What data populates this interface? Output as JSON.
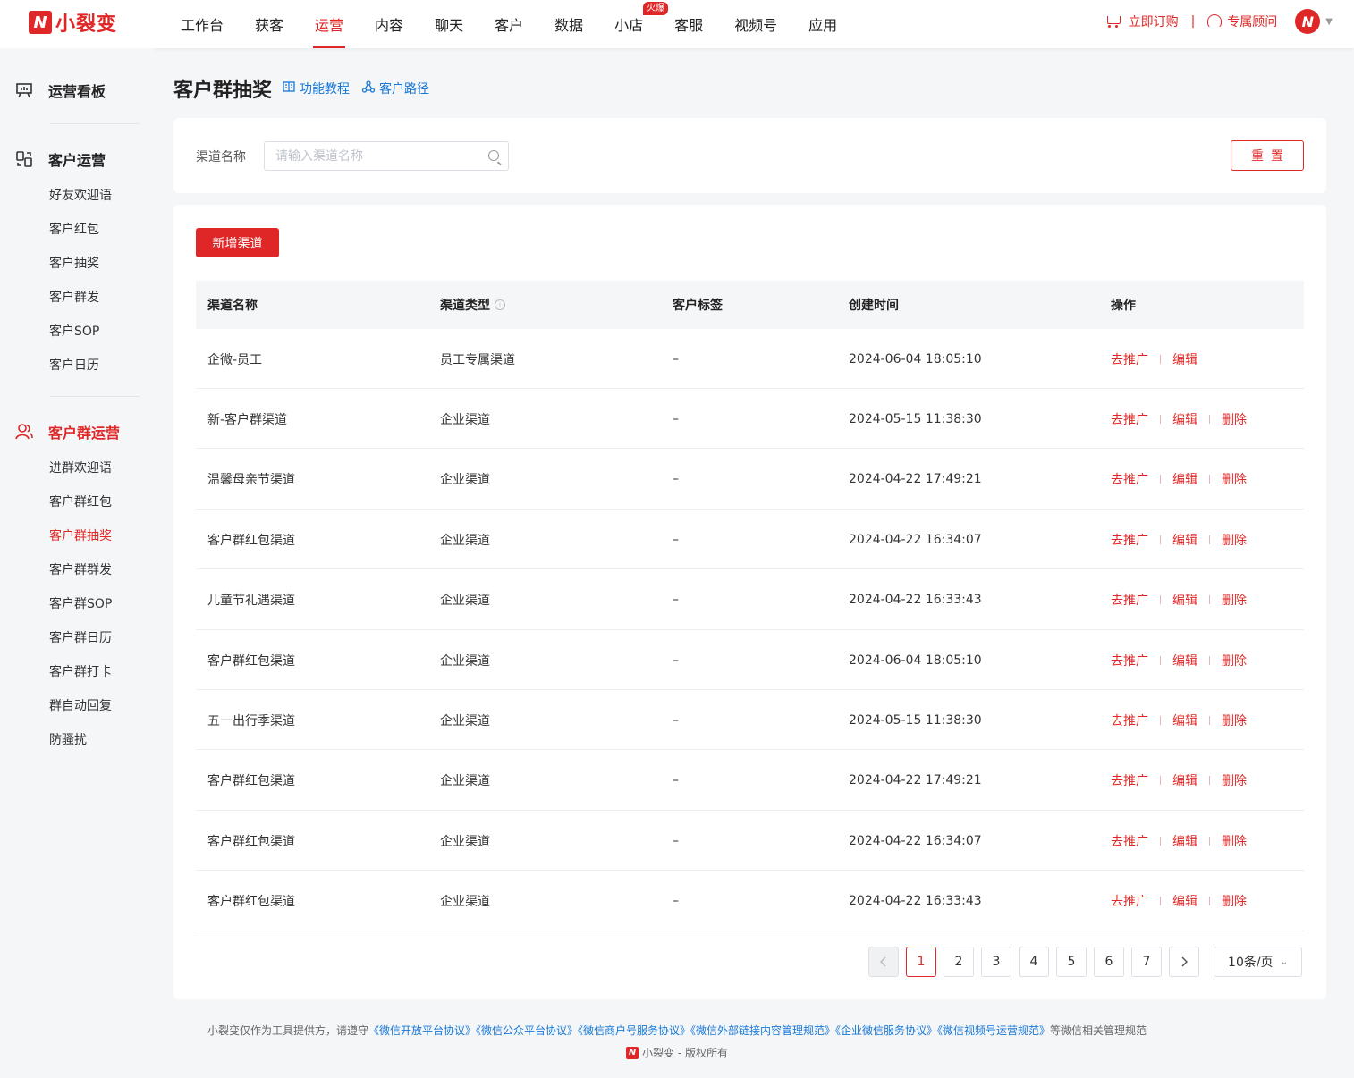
{
  "brand": {
    "name": "小裂变",
    "logo_letter": "N"
  },
  "nav": {
    "items": [
      {
        "label": "工作台"
      },
      {
        "label": "获客"
      },
      {
        "label": "运营",
        "active": true
      },
      {
        "label": "内容"
      },
      {
        "label": "聊天"
      },
      {
        "label": "客户"
      },
      {
        "label": "数据"
      },
      {
        "label": "小店",
        "badge": "火爆"
      },
      {
        "label": "客服"
      },
      {
        "label": "视频号"
      },
      {
        "label": "应用"
      }
    ],
    "subscribe": "立即订购",
    "advisor": "专属顾问",
    "separator": "|"
  },
  "sidebar": {
    "dashboard": "运营看板",
    "customer_ops": {
      "title": "客户运营",
      "items": [
        "好友欢迎语",
        "客户红包",
        "客户抽奖",
        "客户群发",
        "客户SOP",
        "客户日历"
      ]
    },
    "group_ops": {
      "title": "客户群运营",
      "items": [
        "进群欢迎语",
        "客户群红包",
        "客户群抽奖",
        "客户群群发",
        "客户群SOP",
        "客户群日历",
        "客户群打卡",
        "群自动回复",
        "防骚扰"
      ],
      "active_index": 2
    }
  },
  "page": {
    "title": "客户群抽奖",
    "tutorial_link": "功能教程",
    "path_link": "客户路径"
  },
  "filter": {
    "label": "渠道名称",
    "placeholder": "请输入渠道名称",
    "reset": "重置"
  },
  "table": {
    "add_button": "新增渠道",
    "columns": [
      "渠道名称",
      "渠道类型",
      "客户标签",
      "创建时间",
      "操作"
    ],
    "actions": {
      "promote": "去推广",
      "edit": "编辑",
      "delete": "删除"
    },
    "rows": [
      {
        "name": "企微-员工",
        "type": "员工专属渠道",
        "tag": "–",
        "created": "2024-06-04 18:05:10",
        "deletable": false
      },
      {
        "name": "新-客户群渠道",
        "type": "企业渠道",
        "tag": "–",
        "created": "2024-05-15 11:38:30",
        "deletable": true
      },
      {
        "name": "温馨母亲节渠道",
        "type": "企业渠道",
        "tag": "–",
        "created": "2024-04-22 17:49:21",
        "deletable": true
      },
      {
        "name": "客户群红包渠道",
        "type": "企业渠道",
        "tag": "–",
        "created": "2024-04-22 16:34:07",
        "deletable": true
      },
      {
        "name": "儿童节礼遇渠道",
        "type": "企业渠道",
        "tag": "–",
        "created": "2024-04-22 16:33:43",
        "deletable": true
      },
      {
        "name": "客户群红包渠道",
        "type": "企业渠道",
        "tag": "–",
        "created": "2024-06-04 18:05:10",
        "deletable": true
      },
      {
        "name": "五一出行季渠道",
        "type": "企业渠道",
        "tag": "–",
        "created": "2024-05-15 11:38:30",
        "deletable": true
      },
      {
        "name": "客户群红包渠道",
        "type": "企业渠道",
        "tag": "–",
        "created": "2024-04-22 17:49:21",
        "deletable": true
      },
      {
        "name": "客户群红包渠道",
        "type": "企业渠道",
        "tag": "–",
        "created": "2024-04-22 16:34:07",
        "deletable": true
      },
      {
        "name": "客户群红包渠道",
        "type": "企业渠道",
        "tag": "–",
        "created": "2024-04-22 16:33:43",
        "deletable": true
      }
    ]
  },
  "pagination": {
    "pages": [
      "1",
      "2",
      "3",
      "4",
      "5",
      "6",
      "7"
    ],
    "current": "1",
    "page_size": "10条/页"
  },
  "footer": {
    "prefix": "小裂变仅作为工具提供方，请遵守",
    "links": [
      "《微信开放平台协议》",
      "《微信公众平台协议》",
      "《微信商户号服务协议》",
      "《微信外部链接内容管理规范》",
      "《企业微信服务协议》",
      "《微信视频号运营规范》"
    ],
    "suffix": "等微信相关管理规范",
    "copyright": "小裂变 - 版权所有"
  }
}
